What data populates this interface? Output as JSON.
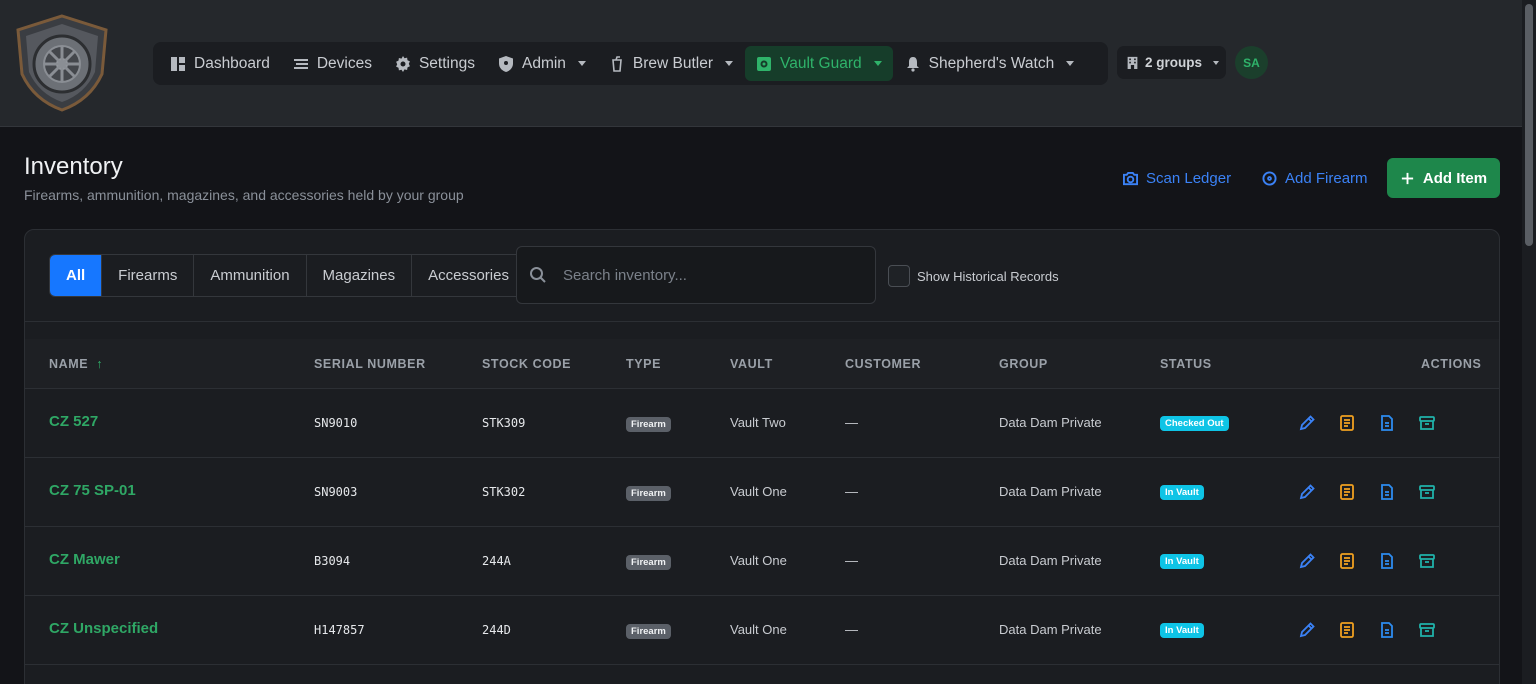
{
  "nav": {
    "items": [
      {
        "label": "Dashboard",
        "icon": "dashboard-icon",
        "has_caret": false,
        "active": false
      },
      {
        "label": "Devices",
        "icon": "devices-icon",
        "has_caret": false,
        "active": false
      },
      {
        "label": "Settings",
        "icon": "gear-icon",
        "has_caret": false,
        "active": false
      },
      {
        "label": "Admin",
        "icon": "shield-icon",
        "has_caret": true,
        "active": false
      },
      {
        "label": "Brew Butler",
        "icon": "cup-icon",
        "has_caret": true,
        "active": false
      },
      {
        "label": "Vault Guard",
        "icon": "vault-icon",
        "has_caret": true,
        "active": true
      },
      {
        "label": "Shepherd's Watch",
        "icon": "bell-icon",
        "has_caret": true,
        "active": false
      }
    ],
    "groups_label": "2 groups",
    "avatar_initials": "SA"
  },
  "page": {
    "title": "Inventory",
    "subtitle": "Firearms, ammunition, magazines, and accessories held by your group",
    "scan_ledger_label": "Scan Ledger",
    "add_firearm_label": "Add Firearm",
    "add_item_label": "Add Item"
  },
  "filters": {
    "tabs": [
      "All",
      "Firearms",
      "Ammunition",
      "Magazines",
      "Accessories"
    ],
    "active": "All",
    "search_placeholder": "Search inventory...",
    "historical_label": "Show Historical Records"
  },
  "table": {
    "columns": {
      "name": "NAME",
      "serial": "SERIAL NUMBER",
      "stock": "STOCK CODE",
      "type": "TYPE",
      "vault": "VAULT",
      "customer": "CUSTOMER",
      "group": "GROUP",
      "status": "STATUS",
      "actions": "ACTIONS"
    },
    "sort_arrow": "↑",
    "rows": [
      {
        "name": "CZ 527",
        "serial": "SN9010",
        "stock": "STK309",
        "type": "Firearm",
        "vault": "Vault Two",
        "customer": "—",
        "group": "Data Dam Private",
        "status": "Checked Out"
      },
      {
        "name": "CZ 75 SP-01",
        "serial": "SN9003",
        "stock": "STK302",
        "type": "Firearm",
        "vault": "Vault One",
        "customer": "—",
        "group": "Data Dam Private",
        "status": "In Vault"
      },
      {
        "name": "CZ Mawer",
        "serial": "B3094",
        "stock": "244A",
        "type": "Firearm",
        "vault": "Vault One",
        "customer": "—",
        "group": "Data Dam Private",
        "status": "In Vault"
      },
      {
        "name": "CZ Unspecified",
        "serial": "H147857",
        "stock": "244D",
        "type": "Firearm",
        "vault": "Vault One",
        "customer": "—",
        "group": "Data Dam Private",
        "status": "In Vault"
      }
    ]
  },
  "colors": {
    "accent_green": "#2fb36a",
    "primary_blue": "#1677ff",
    "status_cyan": "#0ec4e6"
  }
}
